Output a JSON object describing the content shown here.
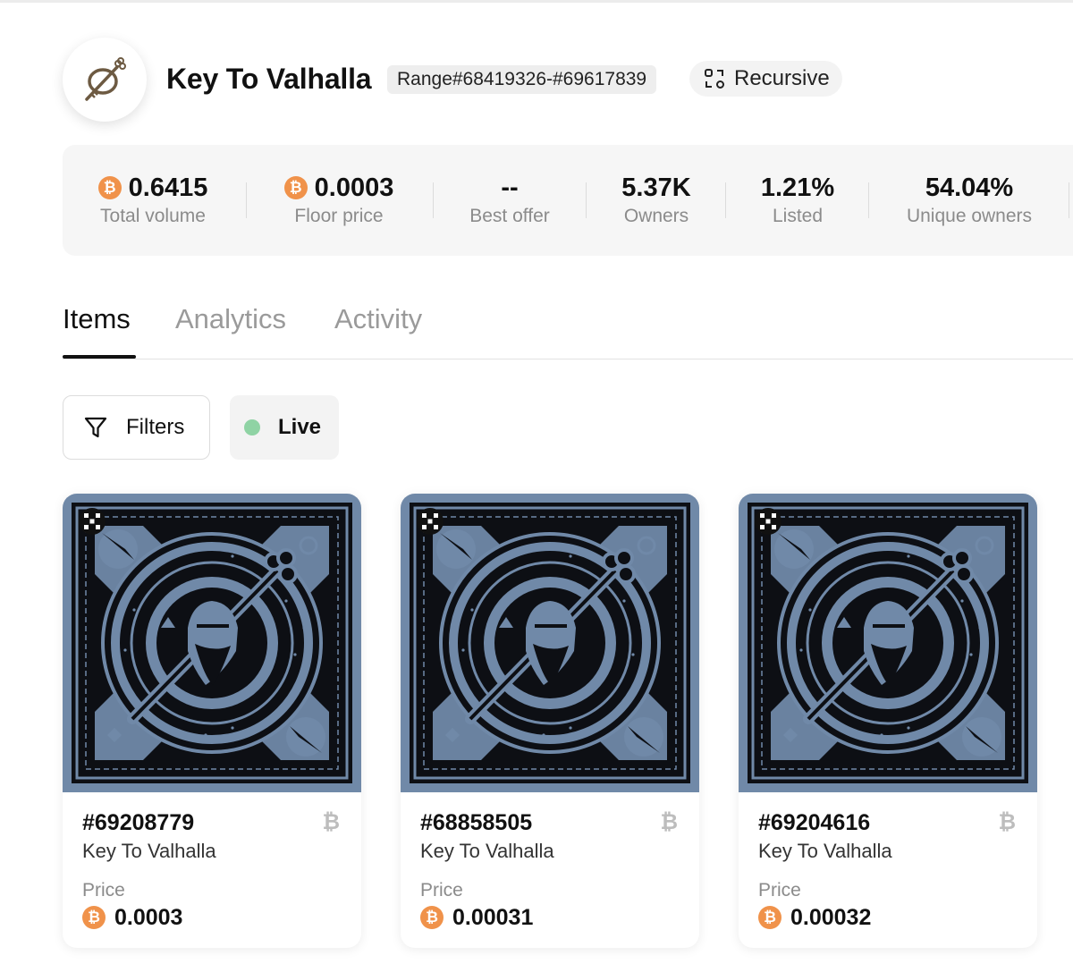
{
  "collection": {
    "title": "Key To Valhalla",
    "range": "Range#68419326-#69617839",
    "recursive_label": "Recursive"
  },
  "stats": [
    {
      "value": "0.6415",
      "label": "Total volume",
      "btc": true
    },
    {
      "value": "0.0003",
      "label": "Floor price",
      "btc": true
    },
    {
      "value": "--",
      "label": "Best offer",
      "btc": false
    },
    {
      "value": "5.37K",
      "label": "Owners",
      "btc": false
    },
    {
      "value": "1.21%",
      "label": "Listed",
      "btc": false
    },
    {
      "value": "54.04%",
      "label": "Unique owners",
      "btc": false
    }
  ],
  "tabs": [
    {
      "label": "Items",
      "active": true
    },
    {
      "label": "Analytics",
      "active": false
    },
    {
      "label": "Activity",
      "active": false
    }
  ],
  "toolbar": {
    "filters_label": "Filters",
    "live_label": "Live"
  },
  "items": [
    {
      "inscription": "#69208779",
      "name": "Key To Valhalla",
      "price_label": "Price",
      "price": "0.0003"
    },
    {
      "inscription": "#68858505",
      "name": "Key To Valhalla",
      "price_label": "Price",
      "price": "0.00031"
    },
    {
      "inscription": "#69204616",
      "name": "Key To Valhalla",
      "price_label": "Price",
      "price": "0.00032"
    }
  ],
  "colors": {
    "btc_orange": "#f0924a",
    "live_green": "#8fd3a4",
    "art_blue": "#7089a8",
    "art_dark": "#0d0f14"
  },
  "icons": [
    "key-logo-icon",
    "recursive-icon",
    "bitcoin-icon",
    "filter-icon",
    "okx-badge-icon"
  ]
}
